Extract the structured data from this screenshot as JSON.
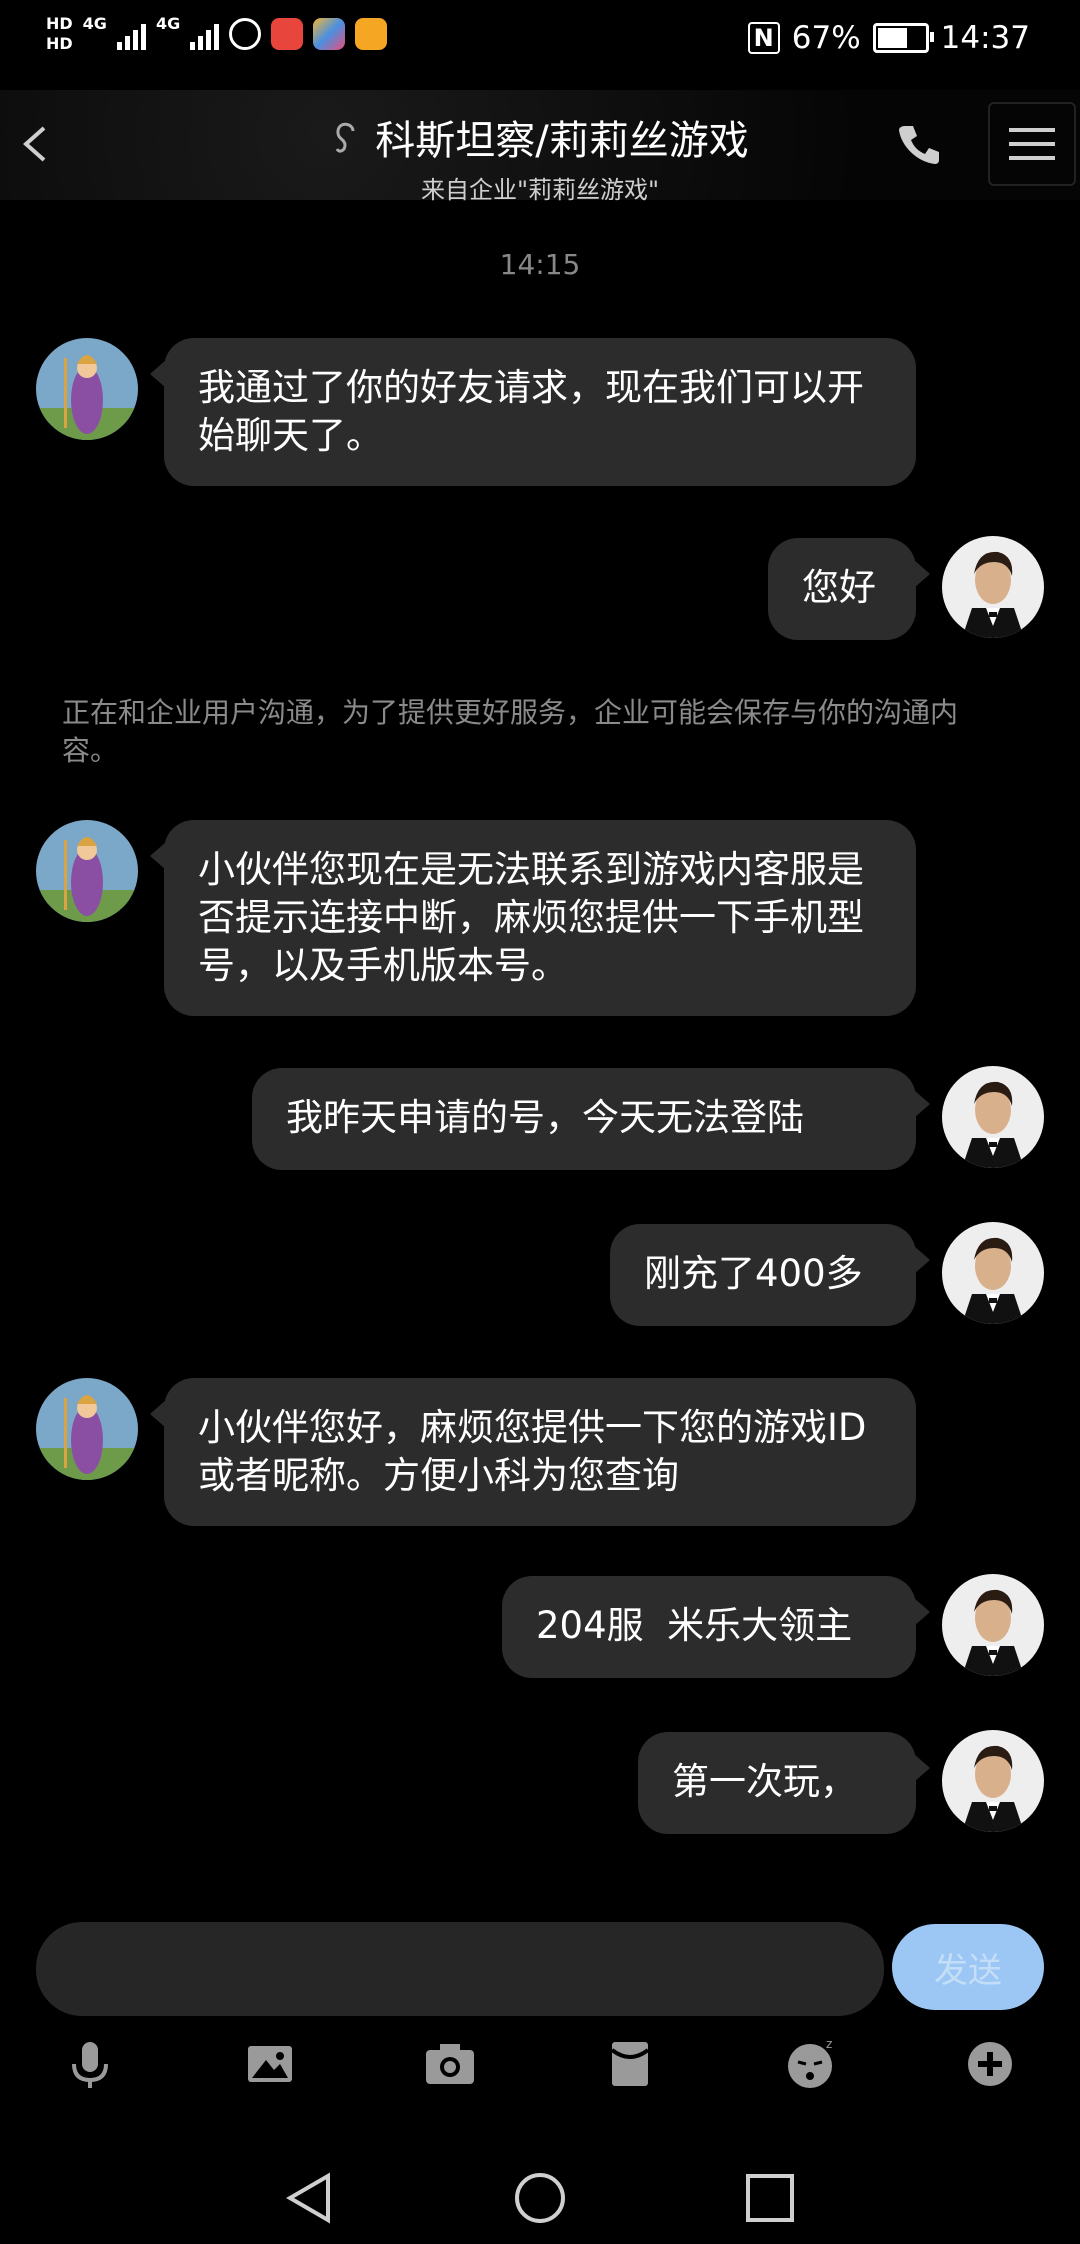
{
  "status_bar": {
    "hd1": "HD",
    "hd2": "HD",
    "net1": "4G",
    "net2": "4G",
    "battery_percent": "67%",
    "battery_level": 0.67,
    "time": "14:37"
  },
  "header": {
    "title": "科斯坦察/莉莉丝游戏",
    "subtitle": "来自企业\"莉莉丝游戏\""
  },
  "timestamp": "14:15",
  "messages": [
    {
      "side": "left",
      "text": "我通过了你的好友请求，现在我们可以开始聊天了。"
    },
    {
      "side": "right",
      "text": "您好"
    },
    {
      "side": "left",
      "text": "小伙伴您现在是无法联系到游戏内客服是否提示连接中断，麻烦您提供一下手机型号，以及手机版本号。"
    },
    {
      "side": "right",
      "text": "我昨天申请的号，今天无法登陆"
    },
    {
      "side": "right",
      "text": "刚充了400多"
    },
    {
      "side": "left",
      "text": "小伙伴您好，麻烦您提供一下您的游戏ID或者昵称。方便小科为您查询"
    },
    {
      "side": "right",
      "text": "204服  米乐大领主"
    },
    {
      "side": "right",
      "text": "第一次玩，"
    }
  ],
  "notice": "正在和企业用户沟通，为了提供更好服务，企业可能会保存与你的沟通内容。",
  "composer": {
    "input_value": "",
    "send_label": "发送"
  },
  "toolbar_icons": [
    "microphone-icon",
    "image-icon",
    "camera-icon",
    "red-packet-icon",
    "emoji-icon",
    "plus-icon"
  ],
  "colors": {
    "bubble": "#2c2c2c",
    "send_button": "#9cc7f5"
  }
}
